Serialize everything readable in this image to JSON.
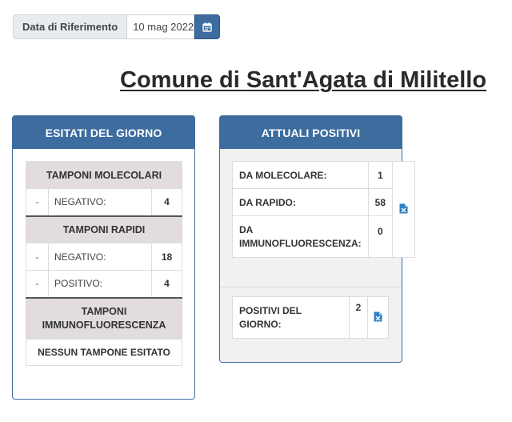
{
  "date_filter": {
    "label": "Data di Riferimento",
    "value": "10 mag 2022",
    "button_icon": "calendar-icon"
  },
  "title": {
    "prefix": "Comune di ",
    "name": "Sant'Agata di Militello"
  },
  "esitati": {
    "header": "ESITATI DEL GIORNO",
    "sections": [
      {
        "title": "TAMPONI MOLECOLARI",
        "rows": [
          {
            "dash": "-",
            "label": "NEGATIVO:",
            "value": "4"
          }
        ]
      },
      {
        "title": "TAMPONI RAPIDI",
        "rows": [
          {
            "dash": "-",
            "label": "NEGATIVO:",
            "value": "18"
          },
          {
            "dash": "-",
            "label": "POSITIVO:",
            "value": "4"
          }
        ]
      },
      {
        "title": "TAMPONI IMMUNOFLUORESCENZA",
        "rows": [],
        "empty_text": "NESSUN TAMPONE ESITATO"
      }
    ]
  },
  "attuali": {
    "header": "ATTUALI POSITIVI",
    "rows": [
      {
        "label": "DA MOLECOLARE:",
        "value": "1"
      },
      {
        "label": "DA RAPIDO:",
        "value": "58"
      },
      {
        "label": "DA IMMUNOFLUORESCENZA:",
        "value": "0"
      }
    ],
    "export_icon": "excel-file-icon",
    "positivi_giorno": {
      "label": "POSITIVI DEL GIORNO:",
      "value": "2",
      "export_icon": "excel-file-icon"
    }
  },
  "colors": {
    "primary": "#3d6c9e",
    "section_bg": "#e2dcdc",
    "panel_bg": "#f1f1f1"
  }
}
